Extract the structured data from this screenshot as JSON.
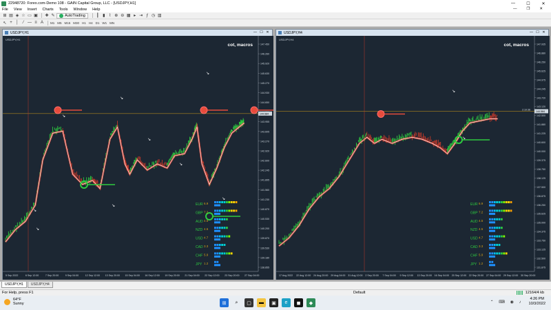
{
  "window": {
    "title": "22948720: Forex.com-Demo 108 - GAIN Capital Group, LLC - [USDJPY,H1]",
    "controls": [
      "—",
      "☐",
      "✕"
    ]
  },
  "menu": {
    "items": [
      "File",
      "View",
      "Insert",
      "Charts",
      "Tools",
      "Window",
      "Help"
    ],
    "mdi_controls": [
      "—",
      "❐",
      "✕"
    ]
  },
  "toolbar": {
    "autotrading_label": "AutoTrading",
    "timeframes": [
      "M1",
      "M5",
      "M15",
      "M30",
      "H1",
      "H4",
      "D1",
      "W1",
      "MN"
    ]
  },
  "charts": [
    {
      "window_title": "USDJPY,H1",
      "inner_label": "USDJPY,H1",
      "overlay_text": "cot, macros",
      "price_labels": [
        "147.450",
        "146.260",
        "145.920",
        "145.630",
        "145.270",
        "144.930",
        "144.650",
        "144.300",
        "143.955",
        "143.605",
        "143.270",
        "142.920",
        "142.600",
        "142.245",
        "141.895",
        "141.560",
        "141.230",
        "140.870",
        "140.530",
        "140.200",
        "139.870",
        "139.530",
        "139.180",
        "138.855"
      ],
      "current_price": "144.584",
      "time_labels": [
        "5 Sep 2022",
        "6 Sep 12:00",
        "7 Sep 20:00",
        "9 Sep 04:00",
        "12 Sep 12:00",
        "13 Sep 20:00",
        "15 Sep 04:00",
        "16 Sep 12:00",
        "19 Sep 20:00",
        "21 Sep 04:00",
        "22 Sep 12:00",
        "23 Sep 20:00",
        "27 Sep 04:00"
      ],
      "strength": [
        {
          "currency": "EUR",
          "value": "6.9",
          "color": "#e74c3c"
        },
        {
          "currency": "GBP",
          "value": "7.2",
          "color": "#27ae60"
        },
        {
          "currency": "AUD",
          "value": "4.5",
          "color": "#27ae60"
        },
        {
          "currency": "NZD",
          "value": "4.5",
          "color": "#27ae60"
        },
        {
          "currency": "USD",
          "value": "4.7",
          "color": "#27ae60"
        },
        {
          "currency": "CAD",
          "value": "3.3",
          "color": "#27ae60"
        },
        {
          "currency": "CHF",
          "value": "5.9",
          "color": "#27ae60"
        },
        {
          "currency": "JPY",
          "value": "1.2",
          "color": "#27ae60"
        }
      ]
    },
    {
      "window_title": "USDJPY,H4",
      "inner_label": "USDJPY,H4",
      "overlay_text": "cot, macros",
      "price_labels": [
        "147.935",
        "146.880",
        "146.250",
        "145.625",
        "144.975",
        "144.245",
        "143.720",
        "143.120",
        "142.500",
        "141.880",
        "141.225",
        "140.600",
        "140.000",
        "139.375",
        "138.750",
        "138.125",
        "137.500",
        "136.875",
        "136.250",
        "135.625",
        "135.000",
        "134.375",
        "133.750",
        "133.125",
        "132.500",
        "131.875"
      ],
      "current_price": "144.584",
      "sub_label": "2:10:36",
      "time_labels": [
        "17 Aug 2022",
        "22 Aug 12:00",
        "24 Aug 20:00",
        "29 Aug 04:00",
        "31 Aug 12:00",
        "2 Sep 20:00",
        "7 Sep 04:00",
        "9 Sep 12:00",
        "13 Sep 20:00",
        "16 Sep 04:00",
        "20 Sep 12:00",
        "22 Sep 20:00",
        "27 Sep 04:00",
        "29 Sep 12:00",
        "30 Sep 20:00"
      ],
      "strength": [
        {
          "currency": "EUR",
          "value": "6.9",
          "color": "#e74c3c"
        },
        {
          "currency": "GBP",
          "value": "7.2",
          "color": "#27ae60"
        },
        {
          "currency": "AUD",
          "value": "4.5",
          "color": "#27ae60"
        },
        {
          "currency": "NZD",
          "value": "4.5",
          "color": "#27ae60"
        },
        {
          "currency": "USD",
          "value": "4.7",
          "color": "#27ae60"
        },
        {
          "currency": "CAD",
          "value": "3.3",
          "color": "#27ae60"
        },
        {
          "currency": "CHF",
          "value": "5.9",
          "color": "#27ae60"
        },
        {
          "currency": "JPY",
          "value": "1.2",
          "color": "#27ae60"
        }
      ]
    }
  ],
  "tabs": [
    "USDJPY,H1",
    "USDJPY,H4"
  ],
  "status": {
    "help": "For Help, press F1",
    "profile": "Default",
    "traffic": "12164/4 kb"
  },
  "taskbar": {
    "weather_temp": "64°F",
    "weather_desc": "Sunny",
    "time": "4:26 PM",
    "date": "10/3/2022"
  }
}
